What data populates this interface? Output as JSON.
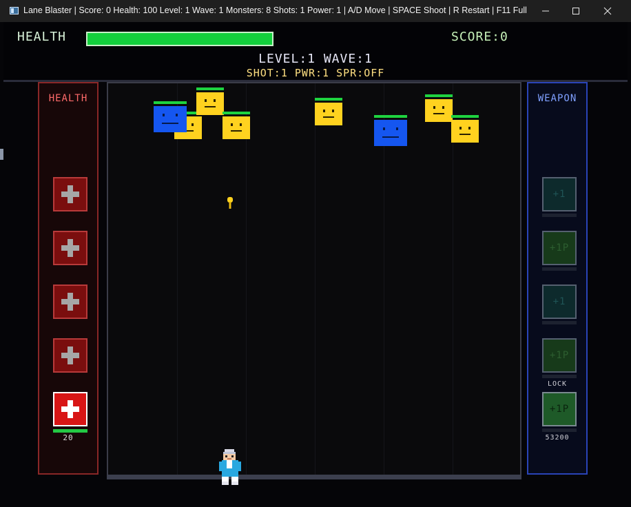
{
  "window": {
    "title": "Lane Blaster  |  Score: 0  Health: 100  Level: 1  Wave: 1  Monsters: 8  Shots: 1  Power: 1  |  A/D Move  |  SPACE Shoot  |  R Restart  |  F11 Full..."
  },
  "hud": {
    "health_label": "HEALTH",
    "health_pct": 100,
    "score_text": "SCORE:0",
    "level_wave_text": "LEVEL:1  WAVE:1",
    "stats_text": "SHOT:1  PWR:1  SPR:OFF"
  },
  "left_panel": {
    "title": "HEALTH",
    "slots": [
      {
        "icon": "plus-icon",
        "active": false
      },
      {
        "icon": "plus-icon",
        "active": false
      },
      {
        "icon": "plus-icon",
        "active": false
      },
      {
        "icon": "plus-icon",
        "active": false
      },
      {
        "icon": "plus-icon",
        "active": true
      }
    ],
    "active_value": "20"
  },
  "right_panel": {
    "title": "WEAPON",
    "slots": [
      {
        "label": "+1",
        "style": "teal"
      },
      {
        "label": "+1P",
        "style": "green"
      },
      {
        "label": "+1",
        "style": "teal"
      },
      {
        "label": "+1P",
        "style": "green",
        "note": "LOCK"
      },
      {
        "label": "+1P",
        "style": "bright",
        "note": "53200"
      }
    ]
  },
  "arena": {
    "lanes": 6,
    "monsters": [
      {
        "color": "blue",
        "lane": 1,
        "depth": 0.08
      },
      {
        "color": "yellow",
        "lane": 1,
        "depth": 0.11
      },
      {
        "color": "yellow",
        "lane": 2,
        "depth": 0.04
      },
      {
        "color": "yellow",
        "lane": 2,
        "depth": 0.11
      },
      {
        "color": "yellow",
        "lane": 4,
        "depth": 0.07
      },
      {
        "color": "blue",
        "lane": 4,
        "depth": 0.12
      },
      {
        "color": "yellow",
        "lane": 5,
        "depth": 0.06
      },
      {
        "color": "yellow",
        "lane": 5,
        "depth": 0.12
      }
    ],
    "player_lane": 2,
    "colors": {
      "yellow_monster": "#ffd21f",
      "blue_monster": "#1556f0",
      "hp_bar": "#1ed340",
      "bullet": "#ffd21f"
    }
  }
}
